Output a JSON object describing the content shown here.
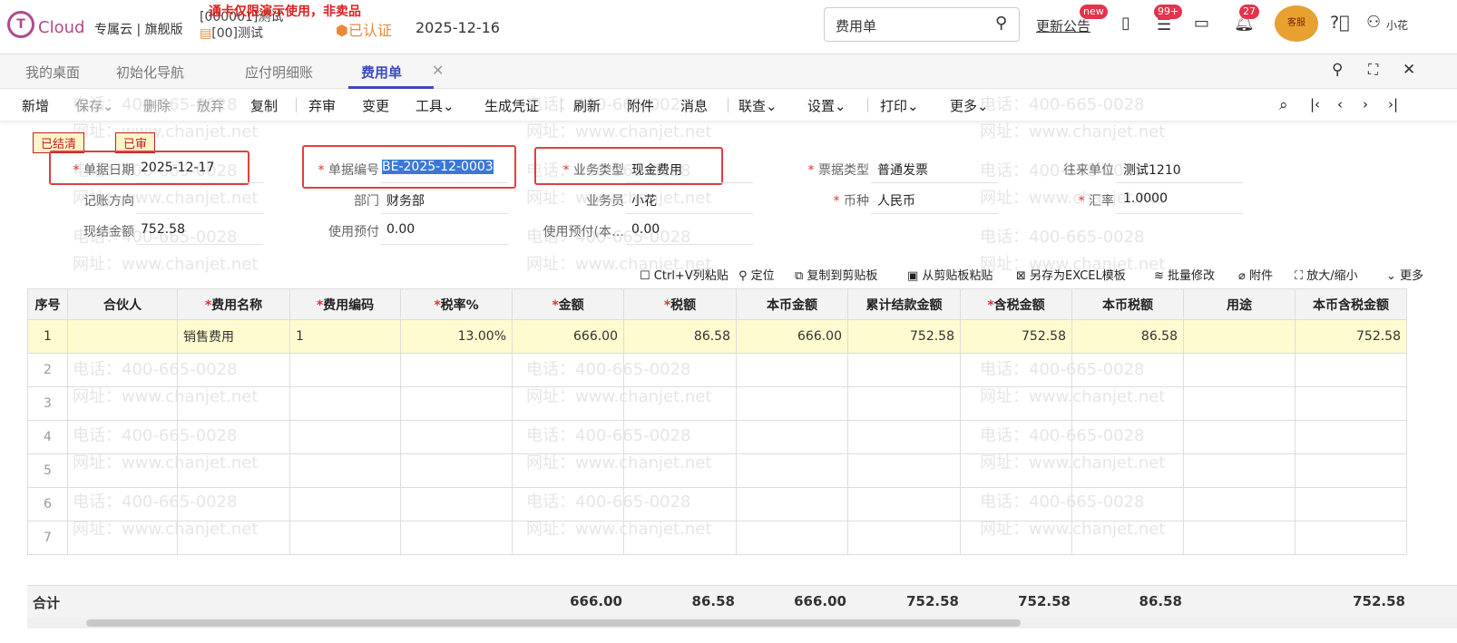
{
  "watermark": {
    "phone": "电话：400-665-0028",
    "site": "网址：www.chanjet.net"
  },
  "header": {
    "logo": "Cloud",
    "edition": "专属云 | 旗舰版",
    "demo_notice": "通卡仅限演示使用，非卖品",
    "account": "[000001]测试",
    "org": "[00]测试",
    "certified": "已认证",
    "date": "2025-12-16",
    "search_value": "费用单",
    "announce": "更新公告",
    "new_badge": "new",
    "todo_badge": "99+",
    "bell_badge": "27",
    "service": "客服",
    "user": "小花"
  },
  "tabs": [
    "我的桌面",
    "初始化导航",
    "应付明细账",
    "费用单"
  ],
  "toolbar": [
    "新增",
    "保存",
    "删除",
    "放弃",
    "复制",
    "弃审",
    "变更",
    "工具",
    "生成凭证",
    "刷新",
    "附件",
    "消息",
    "联查",
    "设置",
    "打印",
    "更多"
  ],
  "status": [
    "已结清",
    "已审"
  ],
  "form": {
    "date_label": "单据日期",
    "date": "2025-12-17",
    "code_label": "单据编号",
    "code": "BE-2025-12-0003",
    "biz_label": "业务类型",
    "biz": "现金费用",
    "invoice_label": "票据类型",
    "invoice": "普通发票",
    "partner_label": "往来单位",
    "partner": "测试1210",
    "dir_label": "记账方向",
    "dept_label": "部门",
    "dept": "财务部",
    "staff_label": "业务员",
    "staff": "小花",
    "cur_label": "币种",
    "cur": "人民币",
    "rate_label": "汇率",
    "rate": "1.0000",
    "cash_label": "现结金额",
    "cash": "752.58",
    "prepay_label": "使用预付",
    "prepay": "0.00",
    "prepay_local_label": "使用预付(本…",
    "prepay_local": "0.00"
  },
  "grid_tools": [
    "Ctrl+V列粘贴",
    "定位",
    "复制到剪贴板",
    "从剪贴板粘贴",
    "另存为EXCEL模板",
    "批量修改",
    "附件",
    "放大/缩小",
    "更多"
  ],
  "columns": [
    "序号",
    "合伙人",
    "费用名称",
    "费用编码",
    "税率%",
    "金额",
    "税额",
    "本币金额",
    "累计结款金额",
    "含税金额",
    "本币税额",
    "用途",
    "本币含税金额"
  ],
  "rows": [
    [
      "1",
      "",
      "销售费用",
      "1",
      "13.00%",
      "666.00",
      "86.58",
      "666.00",
      "752.58",
      "752.58",
      "86.58",
      "",
      "752.58"
    ],
    [
      "2"
    ],
    [
      "3"
    ],
    [
      "4"
    ],
    [
      "5"
    ],
    [
      "6"
    ],
    [
      "7"
    ]
  ],
  "totals": {
    "label": "合计",
    "amount": "666.00",
    "tax": "86.58",
    "local_amount": "666.00",
    "settled": "752.58",
    "with_tax": "752.58",
    "local_tax": "86.58",
    "local_with_tax": "752.58"
  }
}
